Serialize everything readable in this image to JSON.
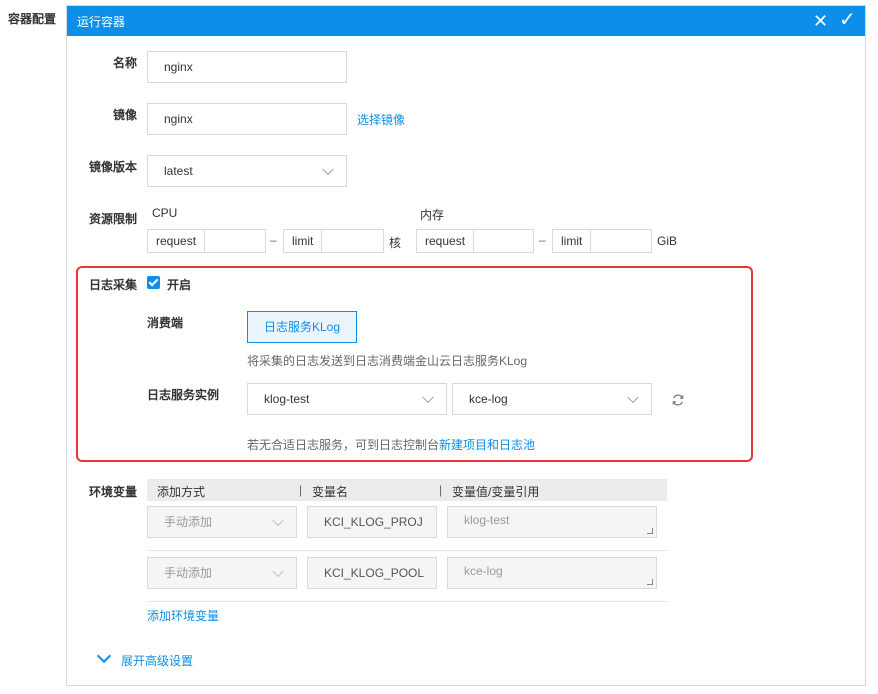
{
  "side_label": "容器配置",
  "panel": {
    "title": "运行容器",
    "close_icon": "✕",
    "confirm_icon": "✓"
  },
  "form": {
    "name": {
      "label": "名称",
      "value": "nginx"
    },
    "image": {
      "label": "镜像",
      "value": "nginx",
      "link": "选择镜像"
    },
    "image_version": {
      "label": "镜像版本",
      "value": "latest"
    },
    "resources": {
      "label": "资源限制",
      "cpu_title": "CPU",
      "mem_title": "内存",
      "request_prefix": "request",
      "limit_prefix": "limit",
      "dash": "–",
      "cpu_unit": "核",
      "mem_unit": "GiB",
      "cpu_request": "",
      "cpu_limit": "",
      "mem_request": "",
      "mem_limit": ""
    }
  },
  "log": {
    "label": "日志采集",
    "checkbox_label": "开启",
    "checked": true,
    "consumer_label": "消费端",
    "consumer_button": "日志服务KLog",
    "consumer_desc": "将采集的日志发送到日志消费端金山云日志服务KLog",
    "instance_label": "日志服务实例",
    "project_value": "klog-test",
    "pool_value": "kce-log",
    "hint_text": "若无合适日志服务，可到日志控制台",
    "hint_link": "新建项目和日志池",
    "highlight_color": "#e53935"
  },
  "env": {
    "label": "环境变量",
    "col_method": "添加方式",
    "col_name": "变量名",
    "col_value": "变量值/变量引用",
    "sep": "|",
    "rows": [
      {
        "method": "手动添加",
        "name": "KCI_KLOG_PROJ",
        "value": "klog-test"
      },
      {
        "method": "手动添加",
        "name": "KCI_KLOG_POOL",
        "value": "kce-log"
      }
    ],
    "add_link": "添加环境变量"
  },
  "advanced": {
    "label": "展开高级设置"
  },
  "colors": {
    "accent": "#0d8ee8",
    "header_bg": "#0d8ee8"
  }
}
